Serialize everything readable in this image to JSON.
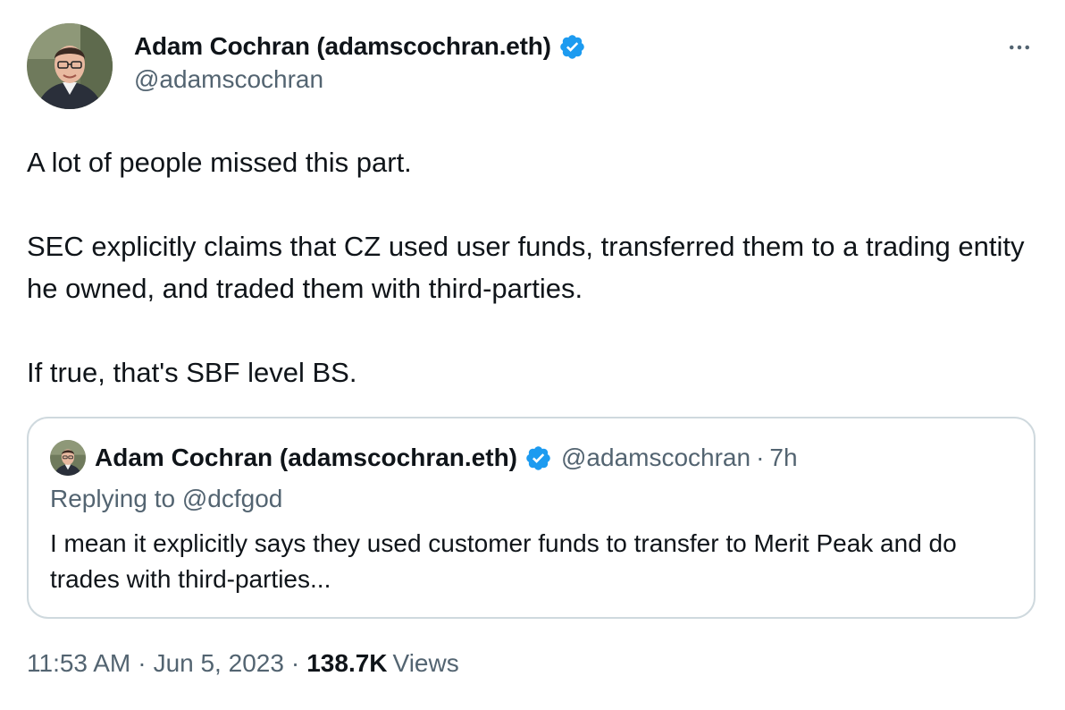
{
  "tweet": {
    "author": {
      "display_name": "Adam Cochran (adamscochran.eth)",
      "handle": "@adamscochran",
      "verified": true
    },
    "more_icon": "more-horizontal-icon",
    "body": {
      "line1": "A lot of people missed this part.",
      "line2": "SEC explicitly claims that CZ used user funds, transferred them to a trading entity he owned, and traded them with third-parties.",
      "line3": "If true, that's SBF level BS."
    },
    "quoted": {
      "display_name": "Adam Cochran (adamscochran.eth)",
      "handle": "@adamscochran",
      "dot": "·",
      "time": "7h",
      "replying_prefix": "Replying to",
      "replying_to": "@dcfgod",
      "text": "I mean it explicitly says they used customer funds to transfer to Merit Peak and do trades with third-parties..."
    },
    "meta": {
      "time": "11:53 AM",
      "sep1": "·",
      "date": "Jun 5, 2023",
      "sep2": "·",
      "views_count": "138.7K",
      "views_label": "Views"
    },
    "colors": {
      "verified_badge": "#1d9bf0",
      "secondary_text": "#536471",
      "primary_text": "#0f1419",
      "border": "#cfd9de"
    }
  }
}
